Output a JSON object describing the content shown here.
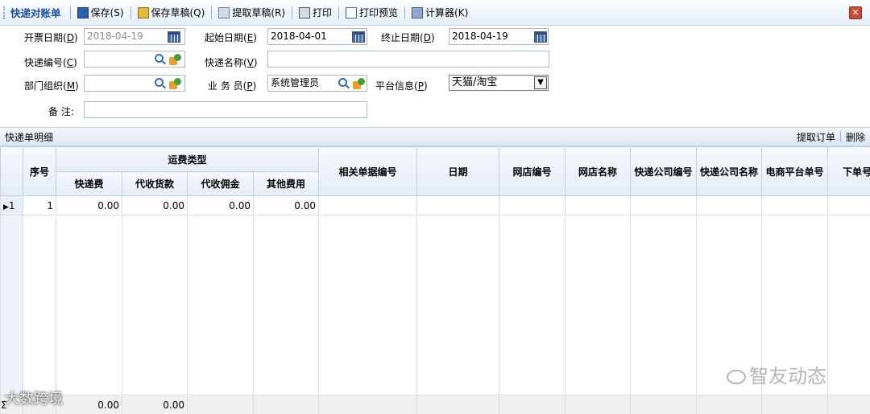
{
  "toolbar": {
    "title": "快递对账单",
    "save": "保存(S)",
    "save_draft": "保存草稿(Q)",
    "get_draft": "提取草稿(R)",
    "print": "打印",
    "print_preview": "打印预览",
    "calculator": "计算器(K)"
  },
  "form": {
    "invoice_date_label": "开票日期(",
    "invoice_date_key": "D",
    "invoice_date_value": "2018-04-19",
    "start_date_label": "起始日期(",
    "start_date_key": "E",
    "start_date_value": "2018-04-01",
    "end_date_label": "终止日期(",
    "end_date_key": "D",
    "end_date_value": "2018-04-19",
    "express_no_label": "快递编号(",
    "express_no_key": "C",
    "express_no_value": "",
    "express_name_label": "快递名称(",
    "express_name_key": "V",
    "express_name_value": "",
    "dept_label": "部门组织(",
    "dept_key": "M",
    "dept_value": "",
    "clerk_label": "业 务 员(",
    "clerk_key": "P",
    "clerk_value": "系统管理员",
    "platform_label": "平台信息(",
    "platform_key": "P",
    "platform_value": "天猫/淘宝",
    "remark_label": "备 注:",
    "remark_value": "",
    "close_paren": ")"
  },
  "detail": {
    "title": "快递单明细",
    "fetch_order": "提取订单",
    "delete": "删除"
  },
  "grid": {
    "headers": {
      "seq": "序号",
      "freight_type": "运费类型",
      "express_fee": "快递费",
      "cod": "代收货款",
      "commission": "代收佣金",
      "other_fee": "其他费用",
      "related_no": "相关单据编号",
      "date": "日期",
      "shop_no": "网店编号",
      "shop_name": "网店名称",
      "company_no": "快递公司编号",
      "company_name": "快递公司名称",
      "platform_no": "电商平台单号",
      "order_no": "下单号"
    },
    "rows": [
      {
        "indicator": "1",
        "seq": "1",
        "express_fee": "0.00",
        "cod": "0.00",
        "commission": "0.00",
        "other_fee": "0.00"
      }
    ],
    "totals": {
      "indicator": "Σ",
      "express_fee": "0.00",
      "cod": "0.00"
    }
  },
  "watermarks": {
    "brand": "智友动态",
    "brand2": "大数跨境"
  }
}
